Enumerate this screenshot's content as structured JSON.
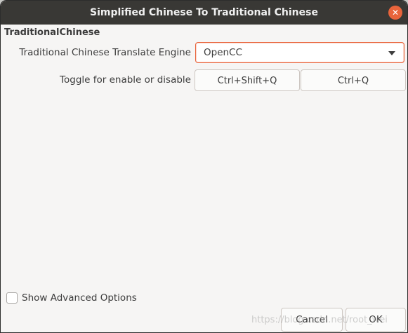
{
  "window": {
    "title": "Simplified Chinese To Traditional Chinese",
    "close_glyph": "✕"
  },
  "section": {
    "title": "TraditionalChinese"
  },
  "engine": {
    "label": "Traditional Chinese Translate Engine",
    "selected": "OpenCC"
  },
  "toggle": {
    "label": "Toggle for enable or disable",
    "key1": "Ctrl+Shift+Q",
    "key2": "Ctrl+Q"
  },
  "advanced": {
    "label": "Show Advanced Options",
    "checked": false
  },
  "buttons": {
    "cancel": "Cancel",
    "ok": "OK"
  },
  "watermark": "https://blog.csdn.net/root_wei",
  "colors": {
    "titlebar": "#393835",
    "accent": "#e9643b",
    "dialog_bg": "#f6f5f4"
  }
}
